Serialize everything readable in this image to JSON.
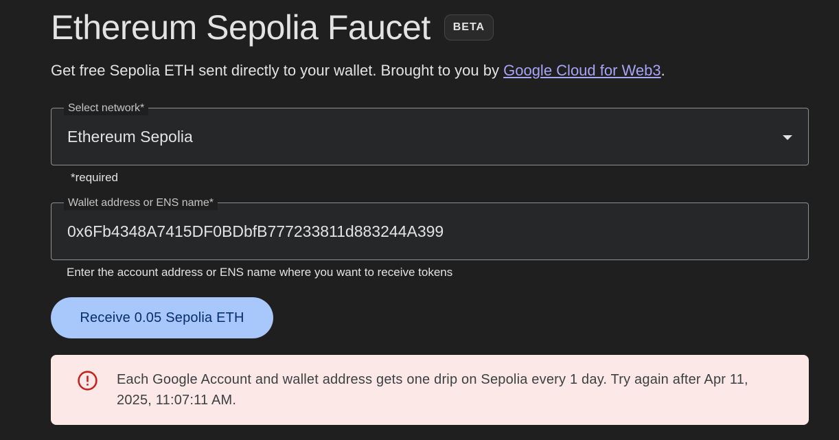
{
  "header": {
    "title": "Ethereum Sepolia Faucet",
    "badge": "BETA"
  },
  "subtitle": {
    "text": "Get free Sepolia ETH sent directly to your wallet. Brought to you by ",
    "link_text": "Google Cloud for Web3",
    "suffix": "."
  },
  "network_select": {
    "label": "Select network*",
    "value": "Ethereum Sepolia",
    "icon": "dropdown-arrow-icon",
    "hint": "*required"
  },
  "address_input": {
    "label": "Wallet address or ENS name*",
    "value": "0x6Fb4348A7415DF0BDbfB777233811d883244A399",
    "hint": "Enter the account address or ENS name where you want to receive tokens"
  },
  "submit": {
    "label": "Receive 0.05 Sepolia ETH"
  },
  "alert": {
    "icon": "error-icon",
    "message": "Each Google Account and wallet address gets one drip on Sepolia every 1 day. Try again after Apr 11, 2025, 11:07:11 AM."
  },
  "colors": {
    "background": "#1f1f1f",
    "link": "#a8a4f6",
    "button": "#a8c7fa",
    "button_text": "#062e6f",
    "alert_background": "#fce8e6",
    "alert_icon": "#c5221f"
  }
}
